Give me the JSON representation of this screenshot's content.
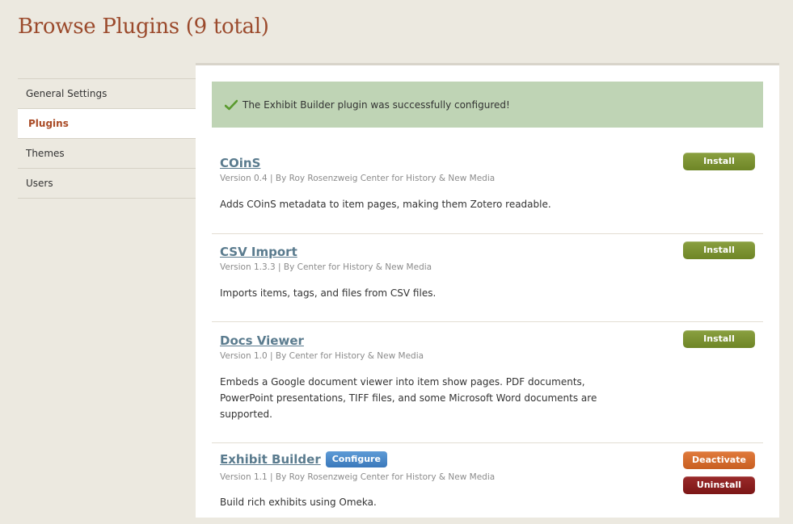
{
  "page": {
    "title": "Browse Plugins (9 total)"
  },
  "sidebar": {
    "items": [
      {
        "label": "General Settings",
        "active": false
      },
      {
        "label": "Plugins",
        "active": true
      },
      {
        "label": "Themes",
        "active": false
      },
      {
        "label": "Users",
        "active": false
      }
    ]
  },
  "flash": {
    "message": "The Exhibit Builder plugin was successfully configured!",
    "icon": "checkmark-icon"
  },
  "plugins": [
    {
      "name": "COinS",
      "meta": "Version 0.4 | By Roy Rosenzweig Center for History & New Media",
      "description": "Adds COinS metadata to item pages, making them Zotero readable.",
      "install_label": "Install"
    },
    {
      "name": "CSV Import",
      "meta": "Version 1.3.3 | By Center for History & New Media",
      "description": "Imports items, tags, and files from CSV files.",
      "install_label": "Install"
    },
    {
      "name": "Docs Viewer",
      "meta": "Version 1.0 | By Center for History & New Media",
      "description_lines": [
        "Embeds a Google document viewer into item show pages. PDF documents,",
        "PowerPoint presentations, TIFF files, and some Microsoft Word documents are",
        "supported."
      ],
      "install_label": "Install"
    },
    {
      "name": "Exhibit Builder",
      "configure_label": "Configure",
      "meta": "Version 1.1 | By Roy Rosenzweig Center for History & New Media",
      "description": "Build rich exhibits using Omeka.",
      "deactivate_label": "Deactivate",
      "uninstall_label": "Uninstall"
    }
  ],
  "colors": {
    "background": "#ece9e0",
    "title": "#9b4a2c",
    "flash_bg": "#bfd4b5",
    "link": "#5a7b8e",
    "install": "#7a922f",
    "deactivate": "#d56d2c",
    "uninstall": "#8b1f1f",
    "configure": "#4a8ac8"
  }
}
